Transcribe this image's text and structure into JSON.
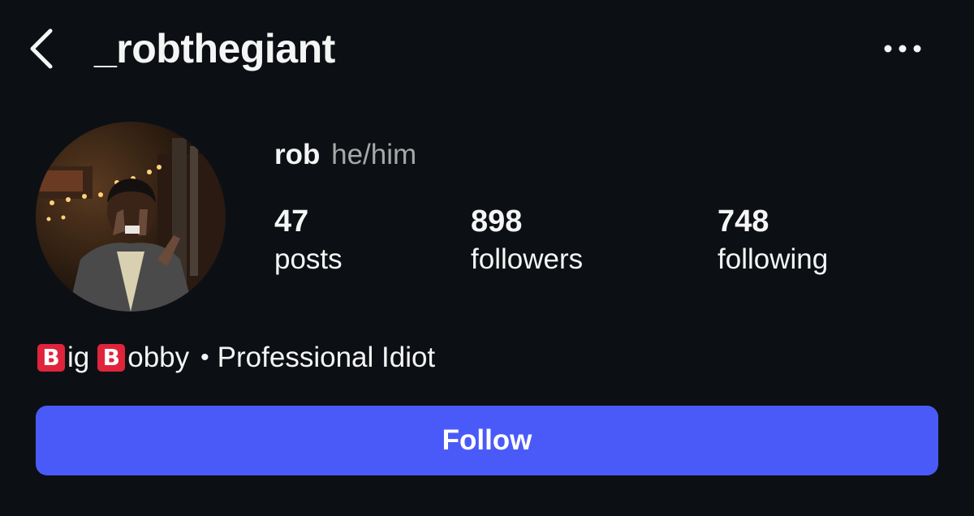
{
  "header": {
    "back_icon": "chevron-left-icon",
    "username": "_robthegiant",
    "more_icon": "more-horizontal-icon"
  },
  "profile": {
    "display_name": "rob",
    "pronouns": "he/him",
    "avatar_description": "profile-photo"
  },
  "stats": {
    "posts": {
      "count": "47",
      "label": "posts"
    },
    "followers": {
      "count": "898",
      "label": "followers"
    },
    "following": {
      "count": "748",
      "label": "following"
    }
  },
  "bio": {
    "emoji_letter_1": "B",
    "word_1_rest": "ig",
    "emoji_letter_2": "B",
    "word_2_rest": "obby",
    "separator": "•",
    "tagline": "Professional Idiot"
  },
  "actions": {
    "follow_label": "Follow"
  },
  "colors": {
    "background": "#0c1014",
    "accent": "#4a5af8",
    "secondary_text": "#a8a8a8",
    "b_emoji": "#e0243c"
  }
}
